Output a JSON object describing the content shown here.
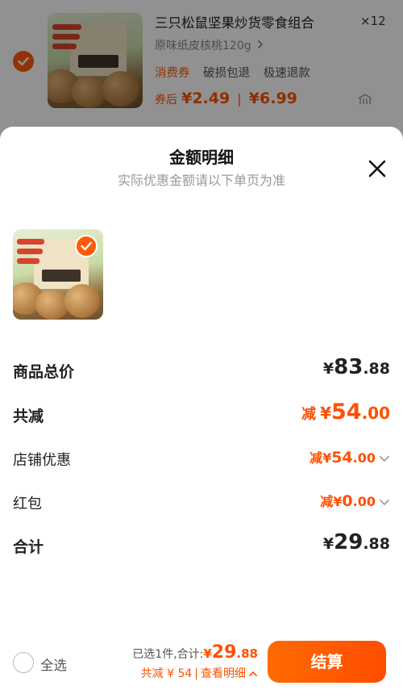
{
  "cart_item": {
    "title": "三只松鼠坚果炒货零食组合",
    "quantity": "×12",
    "spec": "原味纸皮核桃120g",
    "tags": [
      "消费券",
      "破损包退",
      "极速退款"
    ],
    "after_coupon_label": "券后",
    "after_coupon_price": "¥2.49",
    "original_price": "¥6.99",
    "checked": true
  },
  "sheet": {
    "title": "金额明细",
    "subtitle": "实际优惠金额请以下单页为准",
    "rows": [
      {
        "label": "商品总价",
        "prefix": "",
        "currency": "¥",
        "int": "83",
        "dec": ".88"
      },
      {
        "label": "共减",
        "prefix": "减",
        "currency": "¥",
        "int": "54",
        "dec": ".00"
      },
      {
        "label": "店铺优惠",
        "prefix": "减",
        "currency": "¥",
        "int": "54",
        "dec": ".00"
      },
      {
        "label": "红包",
        "prefix": "减",
        "currency": "¥",
        "int": "0",
        "dec": ".00"
      },
      {
        "label": "合计",
        "prefix": "",
        "currency": "¥",
        "int": "29",
        "dec": ".88"
      }
    ]
  },
  "bottom": {
    "select_all_label": "全选",
    "selected_count_text": "已选1件,合计:",
    "total_currency": "¥",
    "total_int": "29",
    "total_dec": ".88",
    "discount_text": "共减 ¥ 54",
    "detail_link": "查看明细",
    "checkout_label": "结算"
  },
  "colors": {
    "accent": "#ff5000",
    "checkbox": "#ff5a0a",
    "overlay": "rgba(0,0,0,0.43)"
  }
}
